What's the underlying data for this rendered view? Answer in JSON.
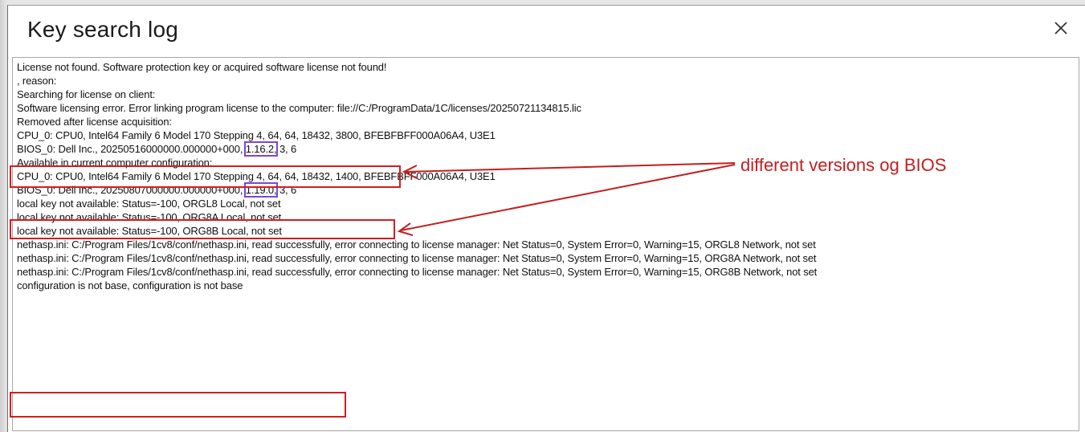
{
  "window": {
    "title": "Key search log",
    "close_icon": "close-icon"
  },
  "log": {
    "lines": [
      "License not found. Software protection key or acquired software license not found!",
      ", reason:",
      "Searching for license on client:",
      "Software licensing error. Error linking program license to the computer: file://C:/ProgramData/1C/licenses/20250721134815.lic",
      "Removed after license acquisition:",
      "CPU_0: CPU0, Intel64 Family 6 Model 170 Stepping 4, 64, 64, 18432, 3800, BFEBFBFF000A06A4, U3E1",
      "BIOS_0: Dell Inc., 20250516000000.000000+000, 1.16.2, 3, 6",
      "Available in current computer configuration:",
      "CPU_0: CPU0, Intel64 Family 6 Model 170 Stepping 4, 64, 64, 18432, 1400, BFEBFBFF000A06A4, U3E1",
      "BIOS_0: Dell Inc., 20250807000000.000000+000, 1.19.0, 3, 6",
      "local key not available: Status=-100, ORGL8 Local, not set",
      "local key not available: Status=-100, ORG8A Local, not set",
      "local key not available: Status=-100, ORG8B Local, not set",
      "nethasp.ini: C:/Program Files/1cv8/conf/nethasp.ini, read successfully, error connecting to license manager: Net Status=0, System Error=0, Warning=15, ORGL8 Network, not set",
      "nethasp.ini: C:/Program Files/1cv8/conf/nethasp.ini, read successfully, error connecting to license manager: Net Status=0, System Error=0, Warning=15, ORG8A Network, not set",
      "nethasp.ini: C:/Program Files/1cv8/conf/nethasp.ini, read successfully, error connecting to license manager: Net Status=0, System Error=0, Warning=15, ORG8B Network, not set",
      "configuration is not base, configuration is not base"
    ],
    "bios_removed": {
      "prefix": "BIOS_0: Dell Inc., 20250516000000.000000+000,",
      "version": "1.16.2,",
      "suffix": " 3, 6"
    },
    "bios_current": {
      "prefix": "BIOS_0: Dell Inc., 20250807000000.000000+000,",
      "version": "1.19.0,",
      "suffix": " 3, 6"
    }
  },
  "annotation": {
    "label": "different versions og BIOS",
    "color": "#c41e1e",
    "highlight_color": "#7d46d6"
  }
}
